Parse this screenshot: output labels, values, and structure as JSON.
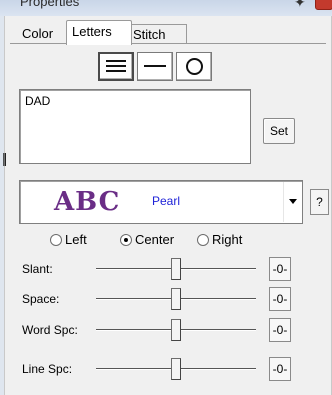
{
  "window": {
    "title": "Properties",
    "pin_glyph": "✦"
  },
  "tabs": [
    {
      "label": "Color"
    },
    {
      "label": "Letters"
    },
    {
      "label": "Stitch"
    }
  ],
  "alignment_buttons": [
    {
      "icon": "multi-line-icon"
    },
    {
      "icon": "single-line-icon"
    },
    {
      "icon": "circle-icon"
    }
  ],
  "text_entry": {
    "value": "DAD"
  },
  "set_button": {
    "label": "Set"
  },
  "font": {
    "preview": "ABC",
    "name": "Pearl",
    "preview_color": "#6a2d86",
    "name_color": "#1e22d8"
  },
  "help_button": {
    "label": "?"
  },
  "justify": {
    "options": [
      "Left",
      "Center",
      "Right"
    ],
    "selected": "Center"
  },
  "sliders": [
    {
      "label": "Slant:",
      "value_label": "-0-",
      "level": 0.5
    },
    {
      "label": "Space:",
      "value_label": "-0-",
      "level": 0.5
    },
    {
      "label": "Word Spc:",
      "value_label": "-0-",
      "level": 0.5
    },
    {
      "label": "Line Spc:",
      "value_label": "-0-",
      "level": 0.5
    }
  ]
}
